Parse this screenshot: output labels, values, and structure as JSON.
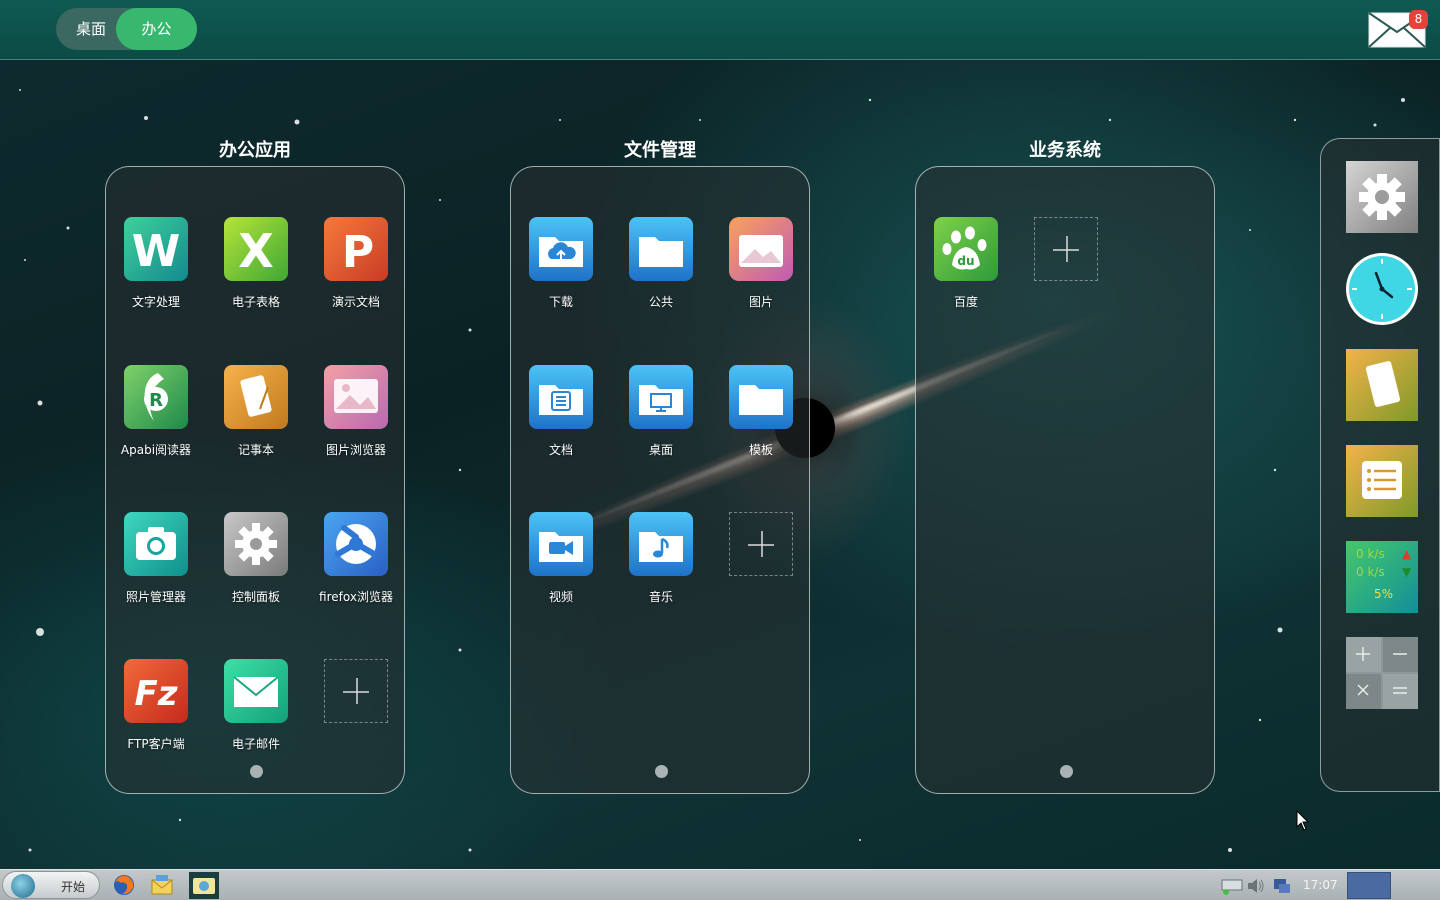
{
  "top_bar": {
    "tabs": [
      {
        "label": "桌面",
        "active": false
      },
      {
        "label": "办公",
        "active": true
      }
    ],
    "mail": {
      "icon": "envelope-icon",
      "unread_count": "8"
    }
  },
  "panels": [
    {
      "title": "办公应用",
      "apps": [
        {
          "label": "文字处理",
          "icon": "word-w-icon"
        },
        {
          "label": "电子表格",
          "icon": "spreadsheet-x-icon"
        },
        {
          "label": "演示文档",
          "icon": "presentation-p-icon"
        },
        {
          "label": "Apabi阅读器",
          "icon": "apabi-reader-icon"
        },
        {
          "label": "记事本",
          "icon": "notepad-icon"
        },
        {
          "label": "图片浏览器",
          "icon": "image-viewer-icon"
        },
        {
          "label": "照片管理器",
          "icon": "camera-icon"
        },
        {
          "label": "控制面板",
          "icon": "gear-icon"
        },
        {
          "label": "firefox浏览器",
          "icon": "firefox-icon"
        },
        {
          "label": "FTP客户端",
          "icon": "filezilla-icon"
        },
        {
          "label": "电子邮件",
          "icon": "email-icon"
        }
      ]
    },
    {
      "title": "文件管理",
      "apps": [
        {
          "label": "下载",
          "icon": "cloud-download-folder-icon"
        },
        {
          "label": "公共",
          "icon": "folder-icon"
        },
        {
          "label": "图片",
          "icon": "pictures-folder-icon"
        },
        {
          "label": "文档",
          "icon": "documents-folder-icon"
        },
        {
          "label": "桌面",
          "icon": "desktop-folder-icon"
        },
        {
          "label": "模板",
          "icon": "templates-folder-icon"
        },
        {
          "label": "视频",
          "icon": "video-folder-icon"
        },
        {
          "label": "音乐",
          "icon": "music-folder-icon"
        }
      ]
    },
    {
      "title": "业务系统",
      "apps": [
        {
          "label": "百度",
          "icon": "baidu-paw-icon"
        }
      ]
    }
  ],
  "side_widgets": [
    {
      "name": "settings-widget",
      "icon": "gear-icon"
    },
    {
      "name": "clock-widget",
      "icon": "analog-clock-icon"
    },
    {
      "name": "notes-widget",
      "icon": "note-icon"
    },
    {
      "name": "list-widget",
      "icon": "list-icon"
    },
    {
      "name": "network-monitor-widget",
      "icon": "network-speed-icon",
      "up": "0 k/s",
      "down": "0 k/s",
      "percent": "5%"
    },
    {
      "name": "calculator-widget",
      "icon": "calculator-icon"
    }
  ],
  "taskbar": {
    "start_label": "开始",
    "clock": "17:07",
    "quick_launch": [
      "firefox-icon",
      "mail-client-icon",
      "file-manager-icon"
    ],
    "tray": [
      "network-icon",
      "volume-icon",
      "display-icon"
    ]
  },
  "colors": {
    "accent": "#38b86f",
    "topbar": "#0e5a52",
    "badge": "#e8403a"
  }
}
